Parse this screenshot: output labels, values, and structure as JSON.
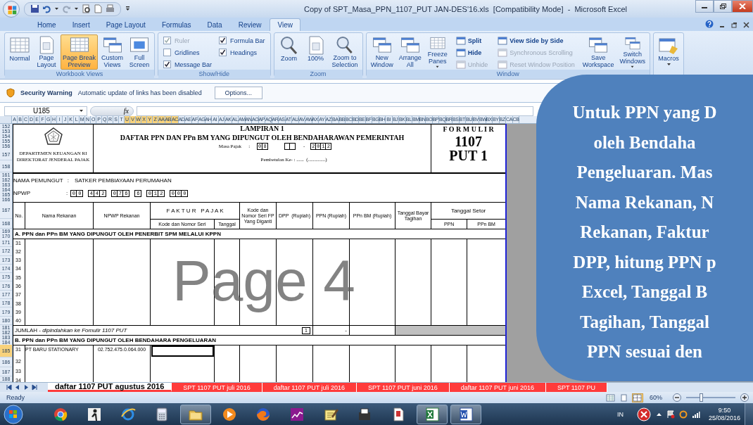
{
  "window": {
    "title": "Copy of SPT_Masa_PPN_1107_PUT JAN-DES'16.xls  [Compatibility Mode]  -  Microsoft Excel"
  },
  "ribbon": {
    "tabs": [
      {
        "label": "Home",
        "selected": false
      },
      {
        "label": "Insert",
        "selected": false
      },
      {
        "label": "Page Layout",
        "selected": false
      },
      {
        "label": "Formulas",
        "selected": false
      },
      {
        "label": "Data",
        "selected": false
      },
      {
        "label": "Review",
        "selected": false
      },
      {
        "label": "View",
        "selected": true
      }
    ],
    "groups": [
      {
        "label": "Workbook Views",
        "items": [
          {
            "kind": "large",
            "label": "Normal",
            "selected": false,
            "dropdown": false
          },
          {
            "kind": "large",
            "label": "Page\nLayout",
            "selected": false,
            "dropdown": false
          },
          {
            "kind": "large",
            "label": "Page Break\nPreview",
            "selected": true,
            "dropdown": false
          },
          {
            "kind": "large",
            "label": "Custom\nViews",
            "selected": false,
            "dropdown": false
          },
          {
            "kind": "large",
            "label": "Full\nScreen",
            "selected": false,
            "dropdown": false
          }
        ]
      },
      {
        "label": "Show/Hide",
        "items": [
          {
            "kind": "check",
            "label": "Ruler",
            "checked": true,
            "disabled": true
          },
          {
            "kind": "check",
            "label": "Gridlines",
            "checked": false,
            "disabled": false
          },
          {
            "kind": "check",
            "label": "Message Bar",
            "checked": true,
            "disabled": false
          },
          {
            "kind": "check",
            "label": "Formula Bar",
            "checked": true,
            "disabled": false
          },
          {
            "kind": "check",
            "label": "Headings",
            "checked": true,
            "disabled": false
          }
        ]
      },
      {
        "label": "Zoom",
        "items": [
          {
            "kind": "large",
            "label": "Zoom",
            "selected": false,
            "dropdown": false
          },
          {
            "kind": "large",
            "label": "100%",
            "selected": false,
            "dropdown": false
          },
          {
            "kind": "large",
            "label": "Zoom to\nSelection",
            "selected": false,
            "dropdown": false
          }
        ]
      },
      {
        "label": "Window",
        "items": [
          {
            "kind": "large",
            "label": "New\nWindow",
            "selected": false,
            "dropdown": false
          },
          {
            "kind": "large",
            "label": "Arrange\nAll",
            "selected": false,
            "dropdown": false
          },
          {
            "kind": "large",
            "label": "Freeze\nPanes",
            "selected": false,
            "dropdown": true
          },
          {
            "kind": "small",
            "label": "Split",
            "disabled": false
          },
          {
            "kind": "small",
            "label": "Hide",
            "disabled": false
          },
          {
            "kind": "small",
            "label": "Unhide",
            "disabled": true
          },
          {
            "kind": "small",
            "label": "View Side by Side",
            "disabled": false
          },
          {
            "kind": "small",
            "label": "Synchronous Scrolling",
            "disabled": true
          },
          {
            "kind": "small",
            "label": "Reset Window Position",
            "disabled": true
          },
          {
            "kind": "large",
            "label": "Save\nWorkspace",
            "selected": false,
            "dropdown": false
          },
          {
            "kind": "large",
            "label": "Switch\nWindows",
            "selected": false,
            "dropdown": true
          }
        ]
      },
      {
        "items": [
          {
            "kind": "large",
            "label": "Macros",
            "selected": false,
            "dropdown": true
          }
        ]
      }
    ]
  },
  "security_bar": {
    "title": "Security Warning",
    "message": "Automatic update of links has been disabled",
    "button": "Options..."
  },
  "formula_bar": {
    "name_box": "U185",
    "function_label": "fx"
  },
  "column_headers": [
    {
      "label": "A",
      "selected": false
    },
    {
      "label": "B",
      "selected": false
    },
    {
      "label": "C",
      "selected": false
    },
    {
      "label": "D",
      "selected": false
    },
    {
      "label": "E",
      "selected": false
    },
    {
      "label": "F",
      "selected": false
    },
    {
      "label": "G",
      "selected": false
    },
    {
      "label": "H",
      "selected": false
    },
    {
      "label": "I",
      "selected": false
    },
    {
      "label": "J",
      "selected": false
    },
    {
      "label": "K",
      "selected": false
    },
    {
      "label": "L",
      "selected": false
    },
    {
      "label": "M",
      "selected": false
    },
    {
      "label": "N",
      "selected": false
    },
    {
      "label": "O",
      "selected": false
    },
    {
      "label": "P",
      "selected": false
    },
    {
      "label": "Q",
      "selected": false
    },
    {
      "label": "R",
      "selected": false
    },
    {
      "label": "S",
      "selected": false
    },
    {
      "label": "T",
      "selected": false
    },
    {
      "label": "U",
      "selected": true
    },
    {
      "label": "V",
      "selected": true
    },
    {
      "label": "W",
      "selected": true
    },
    {
      "label": "X",
      "selected": true
    },
    {
      "label": "Y",
      "selected": true
    },
    {
      "label": "Z",
      "selected": true
    },
    {
      "label": "AA",
      "selected": true
    },
    {
      "label": "AB",
      "selected": true
    },
    {
      "label": "AC",
      "selected": true
    },
    {
      "label": "AD",
      "selected": false
    },
    {
      "label": "AE",
      "selected": false
    },
    {
      "label": "AF",
      "selected": false
    },
    {
      "label": "AG",
      "selected": false
    },
    {
      "label": "AH",
      "selected": false
    },
    {
      "label": "AI",
      "selected": false
    },
    {
      "label": "AJ",
      "selected": false
    },
    {
      "label": "AK",
      "selected": false
    },
    {
      "label": "AL",
      "selected": false
    },
    {
      "label": "AM",
      "selected": false
    },
    {
      "label": "AN",
      "selected": false
    },
    {
      "label": "AO",
      "selected": false
    },
    {
      "label": "AP",
      "selected": false
    },
    {
      "label": "AQ",
      "selected": false
    },
    {
      "label": "AR",
      "selected": false
    },
    {
      "label": "AS",
      "selected": false
    },
    {
      "label": "AT",
      "selected": false
    },
    {
      "label": "AU",
      "selected": false
    },
    {
      "label": "AV",
      "selected": false
    },
    {
      "label": "AW",
      "selected": false
    },
    {
      "label": "AX",
      "selected": false
    },
    {
      "label": "AY",
      "selected": false
    },
    {
      "label": "AZ",
      "selected": false
    },
    {
      "label": "BA",
      "selected": false
    },
    {
      "label": "BB",
      "selected": false
    },
    {
      "label": "BC",
      "selected": false
    },
    {
      "label": "BD",
      "selected": false
    },
    {
      "label": "BE",
      "selected": false
    },
    {
      "label": "BF",
      "selected": false
    },
    {
      "label": "BG",
      "selected": false
    },
    {
      "label": "BH",
      "selected": false
    },
    {
      "label": "BI",
      "selected": false
    },
    {
      "label": "BJ",
      "selected": false
    },
    {
      "label": "BK",
      "selected": false
    },
    {
      "label": "BL",
      "selected": false
    },
    {
      "label": "BM",
      "selected": false
    },
    {
      "label": "BN",
      "selected": false
    },
    {
      "label": "BO",
      "selected": false
    },
    {
      "label": "BP",
      "selected": false
    },
    {
      "label": "BQ",
      "selected": false
    },
    {
      "label": "BR",
      "selected": false
    },
    {
      "label": "BS",
      "selected": false
    },
    {
      "label": "BT",
      "selected": false
    },
    {
      "label": "BU",
      "selected": false
    },
    {
      "label": "BV",
      "selected": false
    },
    {
      "label": "BW",
      "selected": false
    },
    {
      "label": "BX",
      "selected": false
    },
    {
      "label": "BY",
      "selected": false
    },
    {
      "label": "BZ",
      "selected": false
    },
    {
      "label": "CA",
      "selected": false
    },
    {
      "label": "CB",
      "selected": false
    }
  ],
  "row_headers": [
    {
      "label": "152",
      "selected": false
    },
    {
      "label": "153",
      "selected": false
    },
    {
      "label": "154",
      "selected": false
    },
    {
      "label": "155",
      "selected": false
    },
    {
      "label": "156",
      "selected": false
    },
    {
      "label": "157",
      "selected": false
    },
    {
      "label": "158",
      "selected": false
    },
    {
      "label": "161",
      "selected": false
    },
    {
      "label": "162",
      "selected": false
    },
    {
      "label": "163",
      "selected": false
    },
    {
      "label": "164",
      "selected": false
    },
    {
      "label": "165",
      "selected": false
    },
    {
      "label": "166",
      "selected": false
    },
    {
      "label": "167",
      "selected": false
    },
    {
      "label": "168",
      "selected": false
    },
    {
      "label": "169",
      "selected": false
    },
    {
      "label": "170",
      "selected": false
    },
    {
      "label": "171",
      "selected": false
    },
    {
      "label": "172",
      "selected": false
    },
    {
      "label": "173",
      "selected": false
    },
    {
      "label": "174",
      "selected": false
    },
    {
      "label": "175",
      "selected": false
    },
    {
      "label": "176",
      "selected": false
    },
    {
      "label": "177",
      "selected": false
    },
    {
      "label": "178",
      "selected": false
    },
    {
      "label": "179",
      "selected": false
    },
    {
      "label": "180",
      "selected": false
    },
    {
      "label": "181",
      "selected": false
    },
    {
      "label": "182",
      "selected": false
    },
    {
      "label": "183",
      "selected": false
    },
    {
      "label": "184",
      "selected": false
    },
    {
      "label": "185",
      "selected": true
    },
    {
      "label": "186",
      "selected": false
    },
    {
      "label": "187",
      "selected": false
    },
    {
      "label": "188",
      "selected": false
    }
  ],
  "form": {
    "agency_lines": [
      "DEPARTEMEN KEUANGAN RI",
      "DIREKTORAT JENDERAL PAJAK"
    ],
    "attachment": "LAMPIRAN 1",
    "title": "DAFTAR PPN DAN PPn BM YANG DIPUNGUT OLEH BENDAHARAWAN PEMERINTAH",
    "masa_pajak": {
      "label": "Masa Pajak",
      "colon": ":",
      "groups": [
        {
          "kind": "digits",
          "digits": [
            "0",
            "8"
          ]
        },
        {
          "kind": "blank"
        },
        {
          "kind": "separator",
          "text": "-"
        },
        {
          "kind": "digits",
          "digits": [
            "2",
            "0",
            "1",
            "2"
          ]
        }
      ]
    },
    "correction": "Pembetulan Ke- : ......  (..............)",
    "formulir": "F O R M U L I R",
    "form_number": "1107",
    "form_code": "PUT 1",
    "collector": {
      "label": "NAMA PEMUNGUT",
      "colon": ":",
      "value": "SATKER PEMBIAYAAN PERUMAHAN"
    },
    "npwp": {
      "label": "NPWP",
      "colon": ":",
      "groups": [
        [
          "0",
          "0"
        ],
        [
          "4",
          "4",
          "2"
        ],
        [
          "0",
          "7",
          "6"
        ],
        [
          "6"
        ],
        [
          "0",
          "1",
          "2"
        ],
        [
          "0",
          "0",
          "0"
        ]
      ]
    },
    "columns": [
      {
        "label": "No."
      },
      {
        "label": "Nama Rekanan"
      },
      {
        "label": "NPWP Rekanan"
      },
      {
        "label": "F A K T U R   P A J A K",
        "sub": [
          "Kode dan Nomor Seri",
          "Tanggal"
        ]
      },
      {
        "label": "Kode dan Nomor Seri FP Yang Diganti"
      },
      {
        "label": "DPP  (Rupiah)"
      },
      {
        "label": "PPN (Rupiah)"
      },
      {
        "label": "PPn BM (Rupiah)"
      },
      {
        "label": "Tanggal Bayar Tagihan"
      },
      {
        "label": "Tanggal Setor",
        "sub": [
          "PPN",
          "PPn BM"
        ]
      }
    ],
    "sections": [
      {
        "title": "A. PPN dan PPn BM YANG DIPUNGUT OLEH PENERBIT SPM MELALUI KPPN",
        "rows": [
          {
            "no": "31",
            "selected": false
          },
          {
            "no": "32",
            "selected": false
          },
          {
            "no": "33",
            "selected": false
          },
          {
            "no": "34",
            "selected": false
          },
          {
            "no": "35",
            "selected": false
          },
          {
            "no": "36",
            "selected": false
          },
          {
            "no": "37",
            "selected": false
          },
          {
            "no": "38",
            "selected": false
          },
          {
            "no": "39",
            "selected": false
          },
          {
            "no": "40",
            "selected": false
          }
        ],
        "total": {
          "label": "JUMLAH - *dipindahkan ke Fomulir 1107 PUT*",
          "reference": "1",
          "ppn": "-"
        }
      },
      {
        "title": "B. PPN dan PPn BM YANG DIPUNGUT OLEH BENDAHARA PENGELUARAN",
        "rows": [
          {
            "no": "31",
            "name": "PT BARU STATIONARY",
            "npwp": "02.752.475.0.064.000",
            "selected": true
          },
          {
            "no": "32",
            "selected": false
          },
          {
            "no": "33",
            "selected": false
          },
          {
            "no": "34",
            "selected": false
          }
        ]
      }
    ]
  },
  "page_label": "Page 4",
  "sheet_tabs": [
    {
      "label": "daftar 1107 PUT agustus 2016",
      "selected": true,
      "color": "#ff3b3b"
    },
    {
      "label": "SPT 1107 PUT juli 2016",
      "selected": false,
      "color": "#ff3b3b"
    },
    {
      "label": "daftar 1107 PUT juli 2016",
      "selected": false,
      "color": "#ff3b3b"
    },
    {
      "label": "SPT 1107 PUT juni 2016",
      "selected": false,
      "color": "#ff3b3b"
    },
    {
      "label": "daftar 1107 PUT juni 2016",
      "selected": false,
      "color": "#ff3b3b"
    },
    {
      "label": "SPT 1107 PU",
      "selected": false,
      "color": "#ff3b3b"
    }
  ],
  "status_bar": {
    "text": "Ready",
    "views": [
      {
        "selected": false
      },
      {
        "selected": false
      },
      {
        "selected": true
      }
    ],
    "zoom": "60%",
    "zoom_slider": {
      "level": 0.3
    }
  },
  "taskbar": {
    "apps": [
      {
        "open": false
      },
      {
        "open": false
      },
      {
        "open": false
      },
      {
        "open": false
      },
      {
        "open": true
      },
      {
        "open": false
      },
      {
        "open": false
      },
      {
        "open": false
      },
      {
        "open": false
      },
      {
        "open": false
      },
      {
        "open": false
      },
      {
        "open": true
      },
      {
        "open": true
      }
    ],
    "language": "IN",
    "time": "9:50",
    "date": "25/08/2016"
  },
  "callout": {
    "lines": [
      "Untuk PPN yang D",
      "oleh Bendaha",
      "Pengeluaran. Mas",
      "Nama Rekanan, N",
      "Rekanan, Faktur",
      "DPP, hitung PPN p",
      "Excel, Tanggal B",
      "Tagihan, Tanggal",
      "PPN sesuai den"
    ]
  }
}
